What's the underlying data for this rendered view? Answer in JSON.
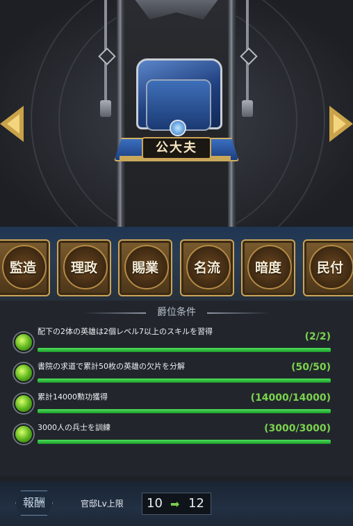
{
  "rank_name": "公大夫",
  "tabs": [
    {
      "label": "監造"
    },
    {
      "label": "理政"
    },
    {
      "label": "賜業"
    },
    {
      "label": "名流"
    },
    {
      "label": "暗度"
    },
    {
      "label": "民付"
    }
  ],
  "conditions_title": "爵位条件",
  "conditions": [
    {
      "text": "配下の2体の英雄は2個レベル7以上のスキルを習得",
      "progress": "(2/2)",
      "ratio": 1.0
    },
    {
      "text": "書院の求道で累計50枚の英雄の欠片を分解",
      "progress": "(50/50)",
      "ratio": 1.0
    },
    {
      "text": "累計14000勲功獲得",
      "progress": "(14000/14000)",
      "ratio": 1.0
    },
    {
      "text": "3000人の兵士を訓練",
      "progress": "(3000/3000)",
      "ratio": 1.0
    }
  ],
  "reward": {
    "tag": "報酬",
    "lv_label": "官邸Lv上限",
    "from": "10",
    "arrow": "➡",
    "to": "12"
  },
  "colors": {
    "accent_gold": "#caa55a",
    "progress_green": "#7bd24e"
  },
  "icons": [
    "left-arrow-icon",
    "right-arrow-icon",
    "official-hat-icon",
    "check-dot-icon"
  ]
}
